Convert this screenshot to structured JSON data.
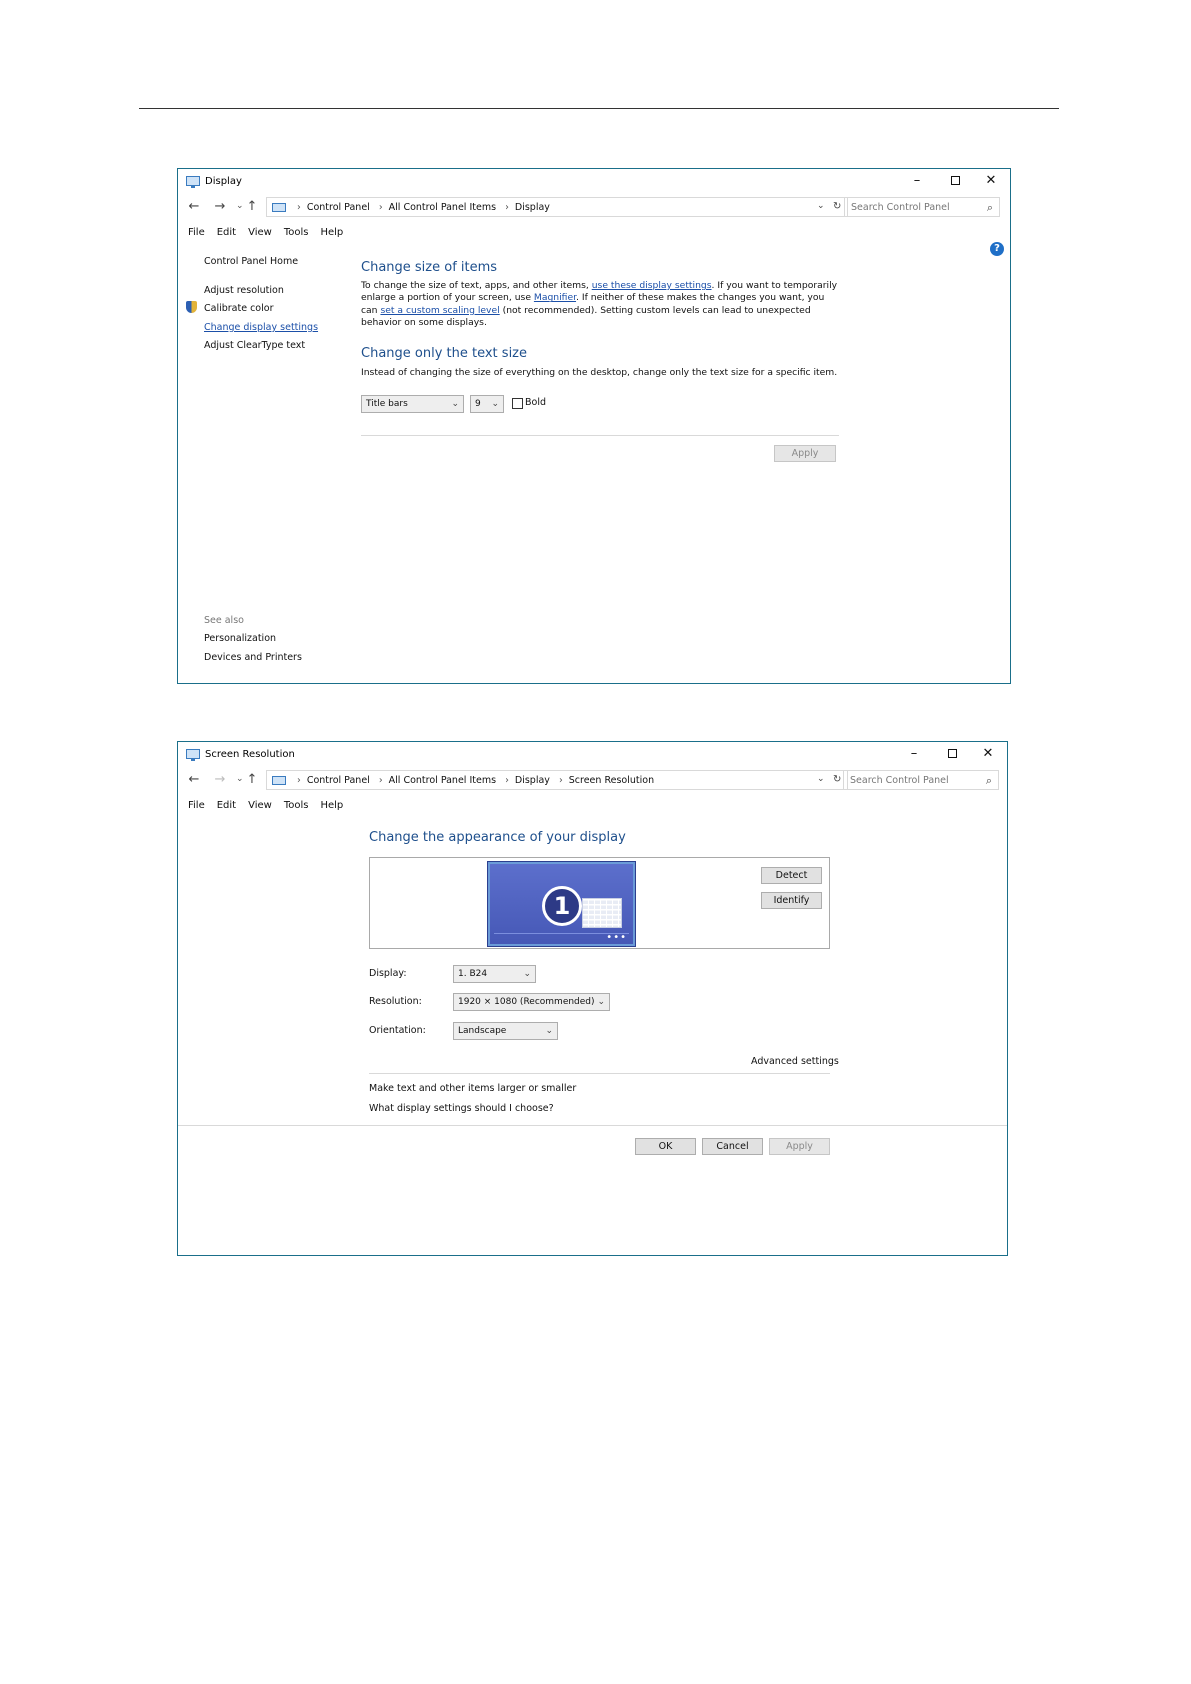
{
  "display_window": {
    "title": "Display",
    "breadcrumbs": [
      "Control Panel",
      "All Control Panel Items",
      "Display"
    ],
    "search_placeholder": "Search Control Panel",
    "menu": [
      "File",
      "Edit",
      "View",
      "Tools",
      "Help"
    ],
    "sidebar": {
      "home": "Control Panel Home",
      "adjust_resolution": "Adjust resolution",
      "calibrate_color": "Calibrate color",
      "change_display_settings": "Change display settings",
      "adjust_cleartype": "Adjust ClearType text",
      "see_also": "See also",
      "personalization": "Personalization",
      "devices_printers": "Devices and Printers"
    },
    "size_heading": "Change size of items",
    "size_para": {
      "t1": "To change the size of text, apps, and other items, ",
      "link1": "use these display settings",
      "t2": ". If you want to temporarily enlarge a portion of your screen, use ",
      "link2": "Magnifier",
      "t3": ". If neither of these makes the changes you want, you can ",
      "link3": "set a custom scaling level",
      "t4": " (not recommended). Setting custom levels can lead to unexpected behavior on some displays."
    },
    "text_heading": "Change only the text size",
    "text_para": "Instead of changing the size of everything on the desktop, change only the text size for a specific item.",
    "item_select": "Title bars",
    "size_select": "9",
    "bold_label": "Bold",
    "apply": "Apply"
  },
  "resolution_window": {
    "title": "Screen Resolution",
    "breadcrumbs": [
      "Control Panel",
      "All Control Panel Items",
      "Display",
      "Screen Resolution"
    ],
    "search_placeholder": "Search Control Panel",
    "menu": [
      "File",
      "Edit",
      "View",
      "Tools",
      "Help"
    ],
    "heading": "Change the appearance of your display",
    "monitor_number": "1",
    "detect": "Detect",
    "identify": "Identify",
    "display_label": "Display:",
    "display_value": "1. B24",
    "resolution_label": "Resolution:",
    "resolution_value": "1920 × 1080 (Recommended)",
    "orientation_label": "Orientation:",
    "orientation_value": "Landscape",
    "advanced": "Advanced settings",
    "link_larger": "Make text and other items larger or smaller",
    "link_choose": "What display settings should I choose?",
    "ok": "OK",
    "cancel": "Cancel",
    "apply": "Apply"
  },
  "colors": {
    "accent": "#1e4f8c",
    "link": "#1b4fa8",
    "window_border": "#1a6f8a"
  }
}
